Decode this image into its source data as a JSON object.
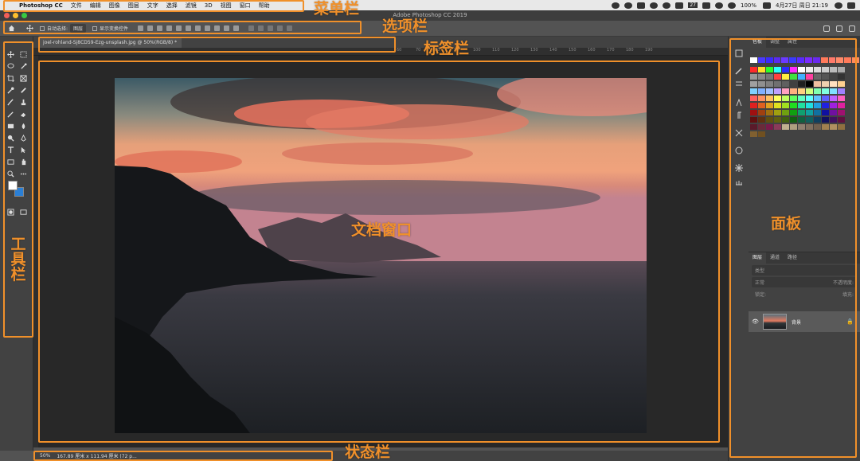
{
  "menubar": {
    "app_name": "Photoshop CC",
    "items": [
      "文件",
      "编辑",
      "图像",
      "图层",
      "文字",
      "选择",
      "滤镜",
      "3D",
      "视图",
      "窗口",
      "帮助"
    ],
    "badge": "27",
    "battery": "100%",
    "datetime": "4月27日 周日  21:19"
  },
  "titlebar": {
    "title": "Adobe Photoshop CC 2019"
  },
  "options": {
    "auto_select_label": "自动选择:",
    "auto_select_value": "图层",
    "show_transform_label": "显示变换控件"
  },
  "tab": {
    "label": "joel-rohland-Sj8CD59-Ezg-unsplash.jpg @ 50%(RGB/8) *"
  },
  "ruler_ticks": [
    "60",
    "70",
    "80",
    "90",
    "100",
    "110",
    "120",
    "130",
    "140",
    "150",
    "160",
    "170",
    "180",
    "190"
  ],
  "colors": {
    "accent": "#f0902a",
    "fg": "#ffffff",
    "bg": "#2a7fd6"
  },
  "panels": {
    "top_tabs": [
      "色板",
      "调整",
      "属性"
    ],
    "layer_tabs": [
      "图层",
      "通道",
      "路径"
    ],
    "filter_placeholder": "类型",
    "blend_mode": "正常",
    "opacity": "不透明度:",
    "lock_label": "锁定:",
    "fill_label": "填充:",
    "layer_name": "背景"
  },
  "status": {
    "zoom": "50%",
    "size": "167.89 厘米 x 111.94 厘米 (72 p..."
  },
  "annotations": {
    "menubar": "菜单栏",
    "options": "选项栏",
    "tabbar": "标签栏",
    "toolbar": "工具栏",
    "document": "文档窗口",
    "panels": "面板",
    "statusbar": "状态栏"
  }
}
